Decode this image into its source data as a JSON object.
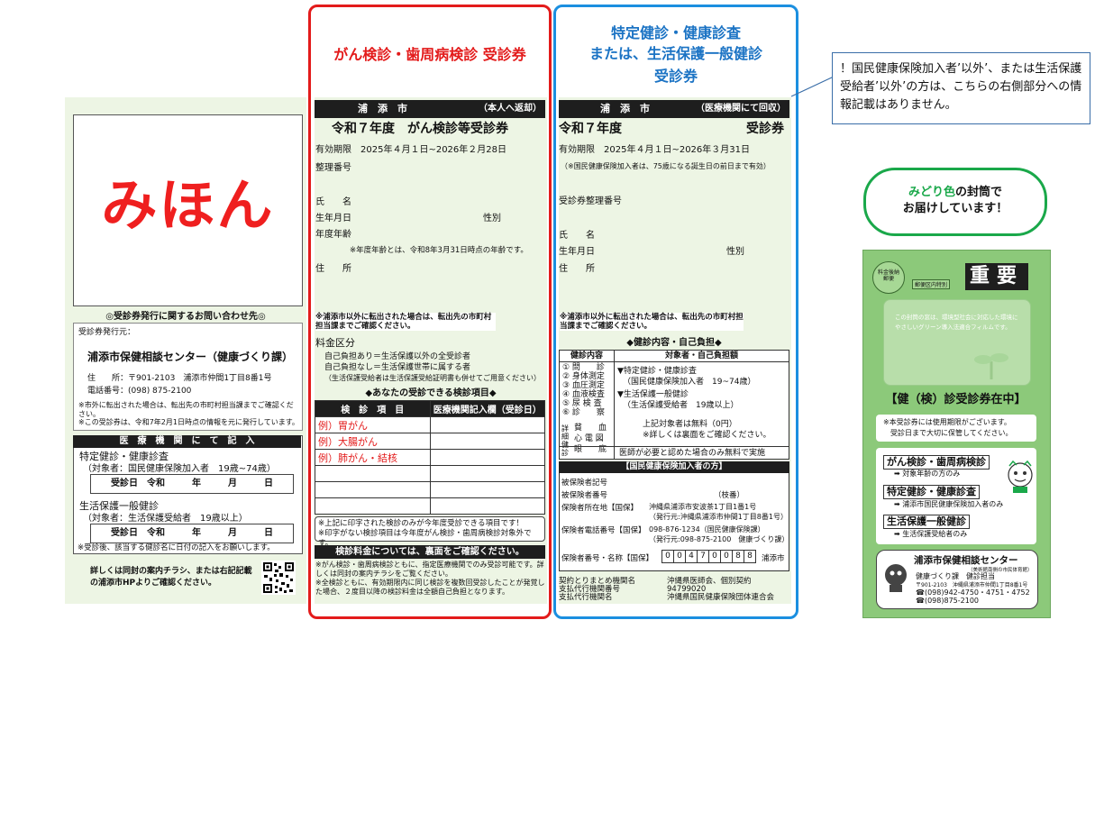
{
  "left": {
    "mihon": "みほん",
    "inquiry_title": "◎受診券発行に関するお問い合わせ先◎",
    "issuer_label": "受診券発行元：",
    "issuer_name": "浦添市保健相談センター（健康づくり課）",
    "address": "住　　所：〒901-2103　浦添市仲間1丁目8番1号",
    "phone": "電話番号：(098) 875-2100",
    "note1": "※市外に転出された場合は、転出先の市町村担当課までご確認ください。",
    "note2": "※この受診券は、令和7年2月1日時点の情報を元に発行しています。",
    "med_header": "医　療　機　関　に　て　記　入",
    "tokutei_title": "特定健診・健康診査",
    "tokutei_target": "（対象者：国民健康保険加入者　19歳~74歳）",
    "date_row": "受診日　令和　　　年　　　月　　　日",
    "seikatsu_title": "生活保護一般健診",
    "seikatsu_target": "（対象者：生活保護受給者　19歳以上）",
    "date_note": "※受診後、該当する健診名に日付の記入をお願いします。",
    "details": "詳しくは同封の案内チラシ、または右記記載の浦添市HPよりご確認ください。"
  },
  "red_section": {
    "label": "がん検診・歯周病検診  受診券",
    "header_city": "浦　添　市",
    "header_note": "（本人へ返却）",
    "title": "令和７年度　がん検診等受診券",
    "validity": "有効期限　2025年４月１日~2026年２月28日",
    "ref_no": "整理番号",
    "name": "氏　　名",
    "dob": "生年月日",
    "sex": "性別",
    "age": "年度年齢",
    "age_note": "※年度年齢とは、令和8年3月31日時点の年齢です。",
    "address": "住　　所",
    "move_note": "※浦添市以外に転出された場合は、転出先の市町村担当課までご確認ください。",
    "fee_title": "料金区分",
    "fee1": "自己負担あり＝生活保護以外の全受診者",
    "fee2": "自己負担なし＝生活保護世帯に属する者",
    "fee3": "（生活保護受給者は生活保護受給証明書も併せてご用意ください）",
    "exam_heading": "◆あなたの受診できる検診項目◆",
    "table_col1": "検　診　項　目",
    "table_col2": "医療機関記入欄（受診日）",
    "table_items": [
      "例）胃がん",
      "例）大腸がん",
      "例）肺がん・結核",
      "",
      "",
      ""
    ],
    "print_note1": "※上記に印字された検診のみが今年度受診できる項目です！",
    "print_note2": "※印字がない検診項目は今年度がん検診・歯周病検診対象外です。",
    "fee_bar": "検診料金については、裏面をご確認ください。",
    "fee_note1": "※がん検診・歯周病検診ともに、指定医療機関でのみ受診可能です。詳しくは同封の案内チラシをご覧ください。",
    "fee_note2": "※全検診ともに、有効期限内に同じ検診を複数回受診したことが発覚した場合、２度目以降の検診料金は全額自己負担となります。"
  },
  "blue_section": {
    "label_line1": "特定健診・健康診査",
    "label_line2": "または、生活保護一般健診",
    "label_line3": "受診券",
    "header_city": "浦　添　市",
    "header_note": "（医療機関にて回収）",
    "title_left": "令和７年度",
    "title_right": "受診券",
    "validity": "有効期限　2025年４月１日~2026年３月31日",
    "validity_note": "（※国民健康保険加入者は、75歳になる誕生日の前日まで有効）",
    "ref_no": "受診券整理番号",
    "name": "氏　　名",
    "dob": "生年月日",
    "sex": "性別",
    "address": "住　　所",
    "move_note": "※浦添市以外に転出された場合は、転出先の市町村担当課までご確認ください。",
    "content_heading": "◆健診内容・自己負担◆",
    "col1": "健診内容",
    "col2": "対象者・自己負担額",
    "items": [
      "① 問　　診",
      "② 身体測定",
      "③ 血圧測定",
      "④ 血液検査",
      "⑤ 尿 検 査",
      "⑥ 診　　察"
    ],
    "target1": "▼特定健診・健康診査",
    "target1b": "（国民健康保険加入者　19~74歳）",
    "target2": "▼生活保護一般健診",
    "target2b": "（生活保護受給者　19歳以上）",
    "free": "上記対象者は無料（0円）",
    "back_note": "※詳しくは裏面をご確認ください。",
    "detail_label": "詳細健診",
    "detail_items": [
      "貧　　血",
      "心 電 図",
      "眼　　底"
    ],
    "detail_note": "医師が必要と認めた場合のみ無料で実施",
    "insured_heading": "【国民健康保険加入者の方】",
    "insured_sym": "被保険者記号",
    "insured_no": "被保険者番号",
    "branch": "（枝番）",
    "insurer_addr_label": "保険者所在地【国保】",
    "insurer_addr": "沖縄県浦添市安波茶1丁目1番1号",
    "insurer_addr2": "（発行元:沖縄県浦添市仲間1丁目8番1号）",
    "insurer_tel_label": "保険者電話番号【国保】",
    "insurer_tel": "098-876-1234（国民健康保険課）",
    "insurer_tel2": "（発行元:098-875-2100　健康づくり課）",
    "insurer_no_label": "保険者番号・名称【国保】",
    "insurer_digits": [
      "0",
      "0",
      "4",
      "7",
      "0",
      "0",
      "8",
      "8"
    ],
    "insurer_name": "浦添市",
    "contract_label1": "契約とりまとめ機関名",
    "contract_label2": "支払代行機関番号",
    "contract_label3": "支払代行機関名",
    "contract_val1": "沖縄県医師会、個別契約",
    "contract_val2": "94799020",
    "contract_val3": "沖縄県国民健康保険団体連合会"
  },
  "callout": {
    "text": "！国民健康保険加入者’以外’、または生活保護受給者’以外’の方は、こちらの右側部分への情報記載はありません。"
  },
  "envelope": {
    "bubble_green": "みどり色",
    "bubble_rest1": "の封筒で",
    "bubble_rest2": "お届けしています！",
    "stamp": "料金後納郵便",
    "stamp2": "郵便区内特別",
    "important": "重要",
    "window_text": "この封筒の窓は、環境型社会に対応した環境にやさしいグリーン導入法適合フィルムです。",
    "notice": "【健（検）診受診券在中】",
    "notice_sub1": "※本受診券には使用期限がございます。",
    "notice_sub2": "受診日まで大切に保管してください。",
    "item1": "がん検診・歯周病検診",
    "item1_sub": "➡ 対象年齢の方のみ",
    "item2": "特定健診・健康診査",
    "item2_sub": "➡ 浦添市国民健康保険加入者のみ",
    "item3": "生活保護一般健診",
    "item3_sub": "➡ 生活保護受給者のみ",
    "center_name": "浦添市保健相談センター",
    "center_sub": "（美術館南側の市民体育館）",
    "dept": "健康づくり課　健診担当",
    "center_addr": "〒901-2103　沖縄県浦添市仲間1丁目8番1号",
    "center_tel1": "☎(098)942-4750・4751・4752",
    "center_tel2": "☎(098)875-2100"
  },
  "colors": {
    "red_frame": "#e31b1b",
    "blue_frame": "#1b8fe0",
    "green_bubble": "#1aa84a",
    "envelope_green": "#8cc97a"
  }
}
